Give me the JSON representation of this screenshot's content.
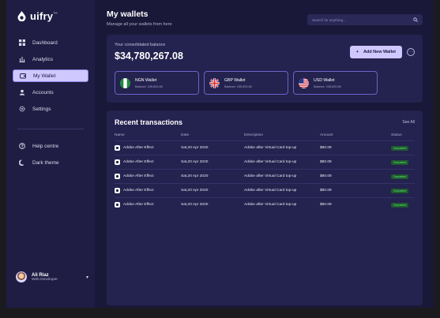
{
  "app": {
    "logo_text": "uifry",
    "logo_mark": "™"
  },
  "sidebar": {
    "items": [
      {
        "label": "Dashboard",
        "icon": "grid-icon"
      },
      {
        "label": "Analytics",
        "icon": "analytics-icon"
      },
      {
        "label": "My Wallet",
        "icon": "wallet-icon",
        "active": true
      },
      {
        "label": "Accounts",
        "icon": "user-icon"
      },
      {
        "label": "Settings",
        "icon": "gear-icon"
      }
    ],
    "secondary_items": [
      {
        "label": "Help centre",
        "icon": "help-icon"
      },
      {
        "label": "Dark theme",
        "icon": "moon-icon"
      }
    ],
    "profile": {
      "name": "Ali Riaz",
      "role": "Web Developer"
    }
  },
  "header": {
    "title": "My wallets",
    "subtitle": "Manage all your wallets from here",
    "search_placeholder": "Search for anything..."
  },
  "balance": {
    "label": "Your consolidated balance",
    "value": "$34,780,267.08",
    "add_button": "Add New Wallet",
    "more_button": "···"
  },
  "wallets": [
    {
      "name": "NGN Wallet",
      "balance": "Balance: 245,800.80",
      "flag": "nigeria"
    },
    {
      "name": "GBP Wallet",
      "balance": "Balance: 245,800.80",
      "flag": "uk"
    },
    {
      "name": "USD Wallet",
      "balance": "Balance: 245,800.80",
      "flag": "usa"
    }
  ],
  "transactions": {
    "title": "Recent transactions",
    "see_all": "See All",
    "columns": [
      "Name",
      "Date",
      "Description",
      "Amount",
      "Status"
    ],
    "rows": [
      {
        "name": "Adobe After Effect",
        "date": "Sat,20 Apr 2020",
        "description": "Adobe after Virtual Card top-up",
        "amount": "$80.09",
        "status": "Deposited"
      },
      {
        "name": "Adobe After Effect",
        "date": "Sat,20 Apr 2020",
        "description": "Adobe after Virtual Card top-up",
        "amount": "$80.09",
        "status": "Deposited"
      },
      {
        "name": "Adobe After Effect",
        "date": "Sat,20 Apr 2020",
        "description": "Adobe after Virtual Card top-up",
        "amount": "$80.09",
        "status": "Deposited"
      },
      {
        "name": "Adobe After Effect",
        "date": "Sat,20 Apr 2020",
        "description": "Adobe after Virtual Card top-up",
        "amount": "$80.09",
        "status": "Deposited"
      },
      {
        "name": "Adobe After Effect",
        "date": "Sat,20 Apr 2020",
        "description": "Adobe after Virtual Card top-up",
        "amount": "$80.09",
        "status": "Deposited"
      }
    ]
  },
  "colors": {
    "accent": "#cfc8ff",
    "background": "#1a1838",
    "panel": "#24224e",
    "status_green": "#5fe17b"
  }
}
